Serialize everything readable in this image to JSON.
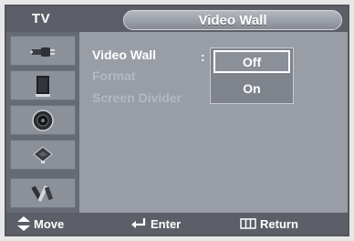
{
  "header": {
    "section": "TV",
    "title": "Video Wall"
  },
  "sidebar": {
    "items": [
      {
        "icon": "antenna-plug-icon"
      },
      {
        "icon": "display-panel-icon"
      },
      {
        "icon": "speaker-icon"
      },
      {
        "icon": "chip-icon"
      },
      {
        "icon": "tools-icon"
      }
    ]
  },
  "menu": {
    "items": [
      {
        "label": "Video Wall",
        "state": "active"
      },
      {
        "label": "Format",
        "state": "disabled"
      },
      {
        "label": "Screen Divider",
        "state": "disabled"
      }
    ],
    "separator": ":"
  },
  "dropdown": {
    "options": [
      "Off",
      "On"
    ],
    "selected": "Off"
  },
  "footer": {
    "move": "Move",
    "enter": "Enter",
    "return": "Return"
  },
  "colors": {
    "panel": "#989da6",
    "header": "#5c5f67",
    "text": "#ffffff",
    "disabled_text": "#b4b8bf"
  }
}
